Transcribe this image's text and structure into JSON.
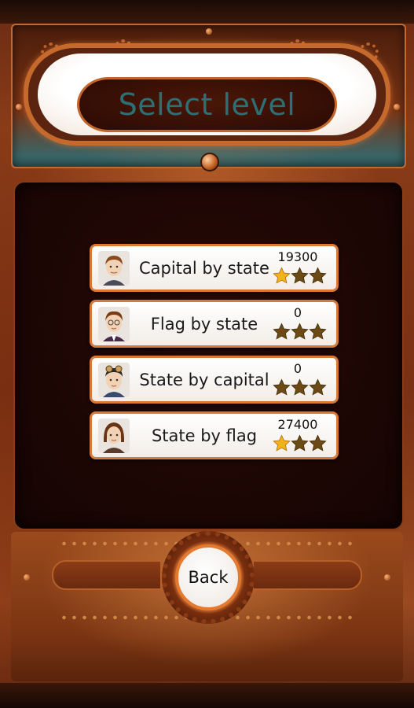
{
  "header": {
    "title": "Select level"
  },
  "levels": [
    {
      "label": "Capital by state",
      "score": "19300",
      "stars_earned": 1,
      "stars_total": 3,
      "avatar_icon": "avatar-boy-icon"
    },
    {
      "label": "Flag by state",
      "score": "0",
      "stars_earned": 0,
      "stars_total": 3,
      "avatar_icon": "avatar-boy-glasses-icon"
    },
    {
      "label": "State by capital",
      "score": "0",
      "stars_earned": 0,
      "stars_total": 3,
      "avatar_icon": "avatar-goggles-icon"
    },
    {
      "label": "State by flag",
      "score": "27400",
      "stars_earned": 1,
      "stars_total": 3,
      "avatar_icon": "avatar-girl-icon"
    }
  ],
  "footer": {
    "back_label": "Back"
  },
  "colors": {
    "accent_orange": "#d87a36",
    "title_teal": "#2c6f74",
    "star_gold": "#f2b21c",
    "star_empty": "#6b4a16"
  }
}
